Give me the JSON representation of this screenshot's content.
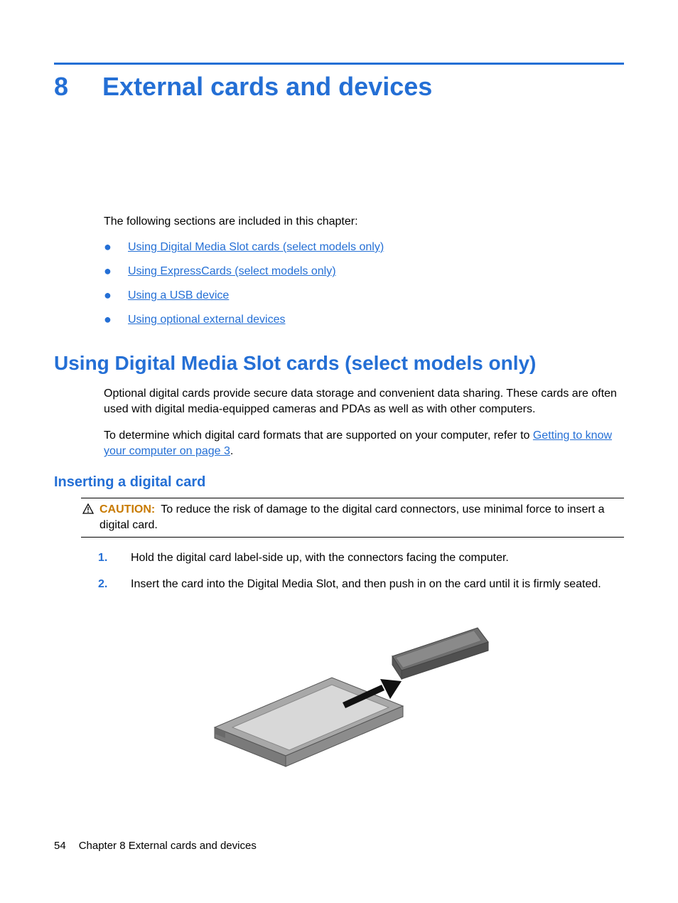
{
  "chapter": {
    "number": "8",
    "title": "External cards and devices"
  },
  "intro": "The following sections are included in this chapter:",
  "toc": [
    "Using Digital Media Slot cards (select models only)",
    "Using ExpressCards (select models only)",
    "Using a USB device",
    "Using optional external devices"
  ],
  "section1": {
    "heading": "Using Digital Media Slot cards (select models only)",
    "para1": "Optional digital cards provide secure data storage and convenient data sharing. These cards are often used with digital media-equipped cameras and PDAs as well as with other computers.",
    "para2_prefix": "To determine which digital card formats that are supported on your computer, refer to ",
    "para2_link": "Getting to know your computer on page 3",
    "para2_suffix": "."
  },
  "subsection": {
    "heading": "Inserting a digital card",
    "caution_label": "CAUTION:",
    "caution_text": "To reduce the risk of damage to the digital card connectors, use minimal force to insert a digital card.",
    "steps": [
      "Hold the digital card label-side up, with the connectors facing the computer.",
      "Insert the card into the Digital Media Slot, and then push in on the card until it is firmly seated."
    ],
    "step_numbers": [
      "1.",
      "2."
    ]
  },
  "footer": {
    "page": "54",
    "chapter_label": "Chapter 8   External cards and devices"
  }
}
